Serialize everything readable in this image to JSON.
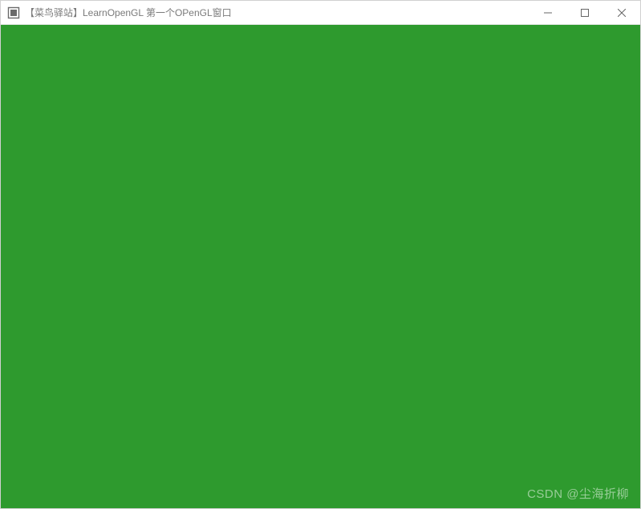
{
  "window": {
    "title": "【菜鸟驿站】LearnOpenGL  第一个OPenGL窗口",
    "icon_name": "app-icon"
  },
  "controls": {
    "minimize_name": "minimize",
    "maximize_name": "maximize",
    "close_name": "close"
  },
  "client": {
    "clear_color": "#2e9a2e"
  },
  "watermark": {
    "text": "CSDN @尘海折柳"
  }
}
